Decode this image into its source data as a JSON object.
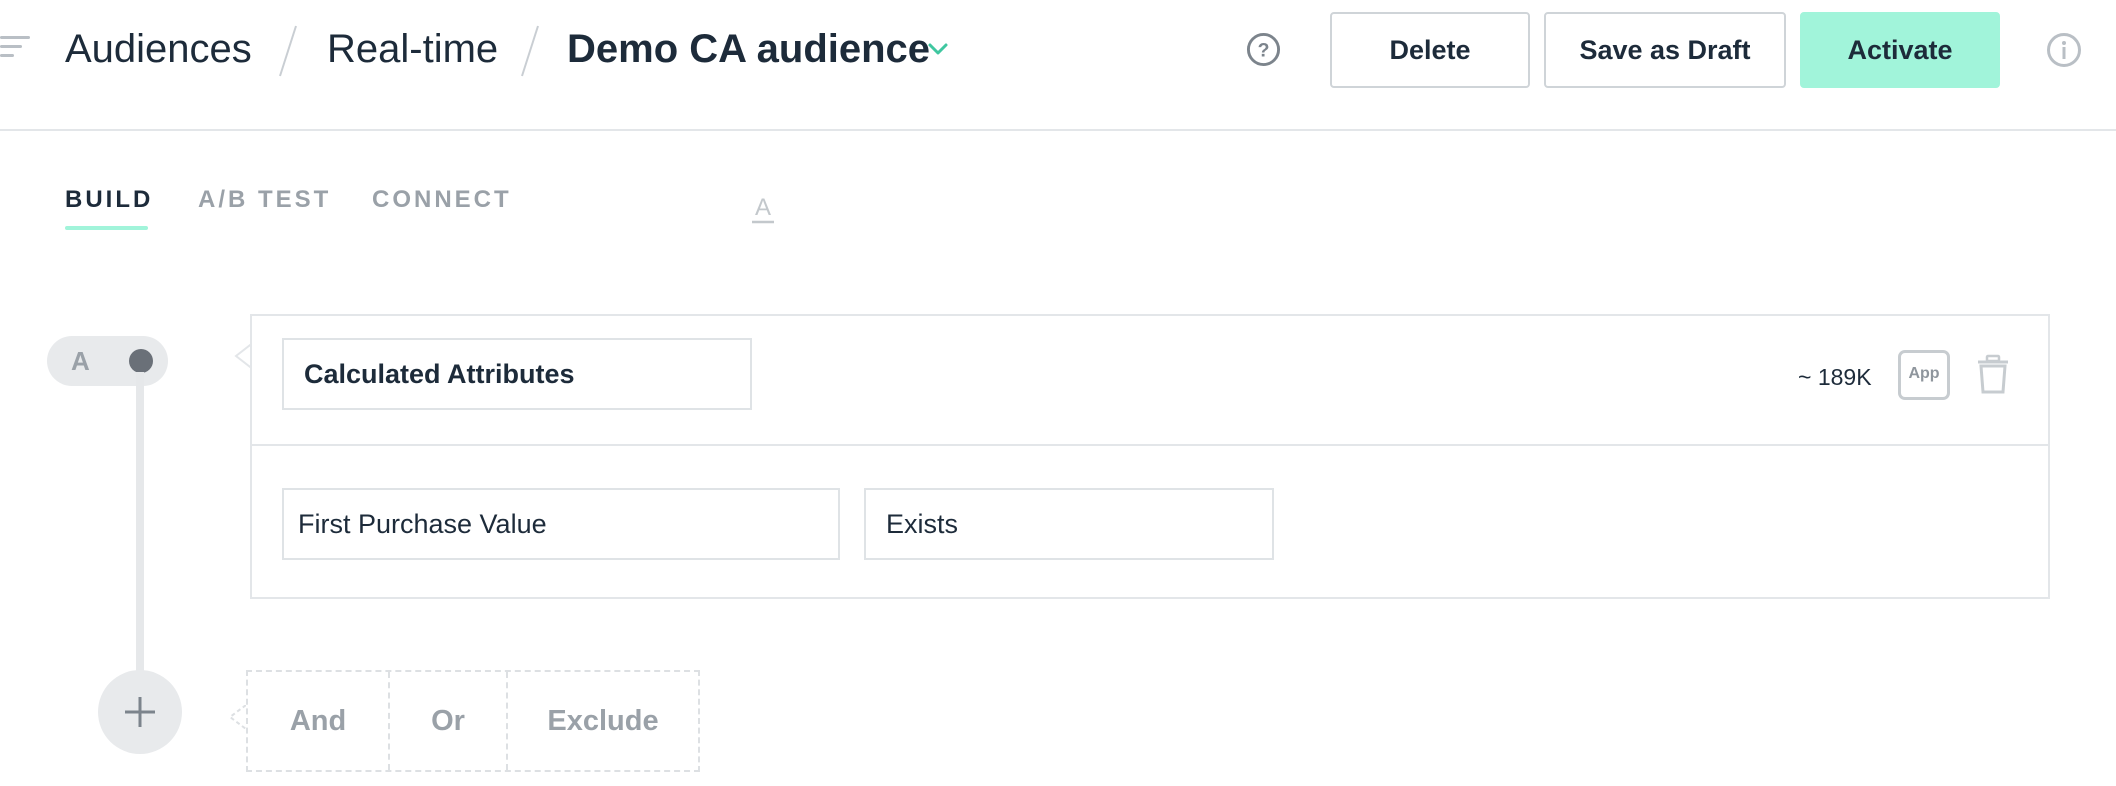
{
  "header": {
    "breadcrumbs": [
      "Audiences",
      "Real-time",
      "Demo CA audience"
    ],
    "buttons": {
      "delete": "Delete",
      "save_draft": "Save as Draft",
      "activate": "Activate"
    }
  },
  "tabs": [
    {
      "label": "BUILD",
      "active": true
    },
    {
      "label": "A/B TEST",
      "active": false
    },
    {
      "label": "CONNECT",
      "active": false
    }
  ],
  "group": {
    "letter": "A",
    "attribute_category": "Calculated Attributes",
    "audience_size": "~ 189K",
    "app_badge": "App",
    "condition": {
      "field": "First Purchase Value",
      "operator": "Exists"
    }
  },
  "add_group": {
    "and": "And",
    "or": "Or",
    "exclude": "Exclude"
  },
  "colors": {
    "accent": "#a1f4da",
    "text": "#1d2b3a",
    "muted": "#9aa1a8",
    "border": "#e3e6e9"
  },
  "icons": [
    "menu-icon",
    "chevron-down-icon",
    "help-icon",
    "info-icon",
    "trash-icon",
    "text-type-icon",
    "plus-icon"
  ]
}
